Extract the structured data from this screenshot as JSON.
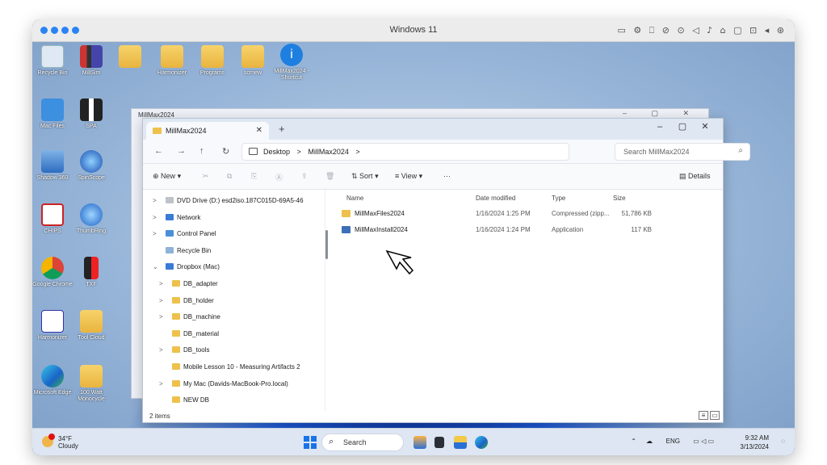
{
  "mac": {
    "title": "Windows 11",
    "accent": "#2a83f4"
  },
  "desktop_icons": [
    {
      "label": "Recycle Bin",
      "icon": "recycle-bin-icon"
    },
    {
      "label": "MillSim",
      "icon": "millsim-icon"
    },
    {
      "label": "Mac Files",
      "icon": "mac-files-icon"
    },
    {
      "label": "SPA",
      "icon": "spa-icon"
    },
    {
      "label": "Shadow 360",
      "icon": "shadow-icon"
    },
    {
      "label": "SpinScope",
      "icon": "spinscope-icon"
    },
    {
      "label": "CHIPS",
      "icon": "chips-icon"
    },
    {
      "label": "ThumbRing",
      "icon": "thumbring-icon"
    },
    {
      "label": "Google Chrome",
      "icon": "chrome-icon"
    },
    {
      "label": "TXF",
      "icon": "txf-icon"
    },
    {
      "label": "Harmonizer",
      "icon": "harmonizer-icon"
    },
    {
      "label": "Tool Cloud",
      "icon": "folder-icon"
    },
    {
      "label": "Microsoft Edge",
      "icon": "edge-icon"
    },
    {
      "label": "100 Watt Monocycle",
      "icon": "folder-icon"
    },
    {
      "label": "",
      "icon": "folder-icon"
    },
    {
      "label": "Harmonizer",
      "icon": "folder-icon"
    },
    {
      "label": "Programs",
      "icon": "folder-icon"
    },
    {
      "label": "scrnew",
      "icon": "folder-icon"
    },
    {
      "label": "MillMax2024 - Shortcut",
      "icon": "info-icon"
    }
  ],
  "back_window": {
    "tab_title": "MillMax2024"
  },
  "explorer": {
    "tab_title": "MillMax2024",
    "breadcrumb": [
      "Desktop",
      ">",
      "MillMax2024",
      ">"
    ],
    "search_placeholder": "Search MillMax2024",
    "commands": {
      "new": "New",
      "sort": "Sort",
      "view": "View",
      "more": "···",
      "details": "Details"
    },
    "nav_items": [
      {
        "label": "DVD Drive (D:) esd2iso.187C015D-69A5-46",
        "chevron": ">",
        "indent": 0,
        "icon_color": "#bfc3c9"
      },
      {
        "label": "Network",
        "chevron": ">",
        "indent": 0,
        "icon_color": "#3a7bd5"
      },
      {
        "label": "Control Panel",
        "chevron": ">",
        "indent": 0,
        "icon_color": "#4a8fd8"
      },
      {
        "label": "Recycle Bin",
        "chevron": "",
        "indent": 0,
        "icon_color": "#8fb2d8"
      },
      {
        "label": "Dropbox (Mac)",
        "chevron": "v",
        "indent": 0,
        "icon_color": "#3a7bd5"
      },
      {
        "label": "DB_adapter",
        "chevron": ">",
        "indent": 1,
        "icon_color": "#eec14c"
      },
      {
        "label": "DB_holder",
        "chevron": ">",
        "indent": 1,
        "icon_color": "#eec14c"
      },
      {
        "label": "DB_machine",
        "chevron": ">",
        "indent": 1,
        "icon_color": "#eec14c"
      },
      {
        "label": "DB_material",
        "chevron": "",
        "indent": 1,
        "icon_color": "#eec14c"
      },
      {
        "label": "DB_tools",
        "chevron": ">",
        "indent": 1,
        "icon_color": "#eec14c"
      },
      {
        "label": "Mobile Lesson 10 - Measuring Artifacts 2",
        "chevron": "",
        "indent": 1,
        "icon_color": "#eec14c"
      },
      {
        "label": "My Mac (Davids-MacBook-Pro.local)",
        "chevron": ">",
        "indent": 1,
        "icon_color": "#eec14c"
      },
      {
        "label": "NEW DB",
        "chevron": "",
        "indent": 1,
        "icon_color": "#eec14c"
      }
    ],
    "columns": {
      "name": "Name",
      "date": "Date modified",
      "type": "Type",
      "size": "Size"
    },
    "files": [
      {
        "name": "MillMaxFiles2024",
        "date": "1/16/2024 1:25 PM",
        "type": "Compressed (zipp...",
        "size": "51,786 KB",
        "icon_color": "#eec14c"
      },
      {
        "name": "MillMaxInstall2024",
        "date": "1/16/2024 1:24 PM",
        "type": "Application",
        "size": "117 KB",
        "icon_color": "#3d6fb8"
      }
    ],
    "status": "2 items"
  },
  "taskbar": {
    "weather_temp": "34°F",
    "weather_desc": "Cloudy",
    "search_label": "Search",
    "tray_lang": "ENG",
    "time": "9:32 AM",
    "date": "3/13/2024"
  }
}
